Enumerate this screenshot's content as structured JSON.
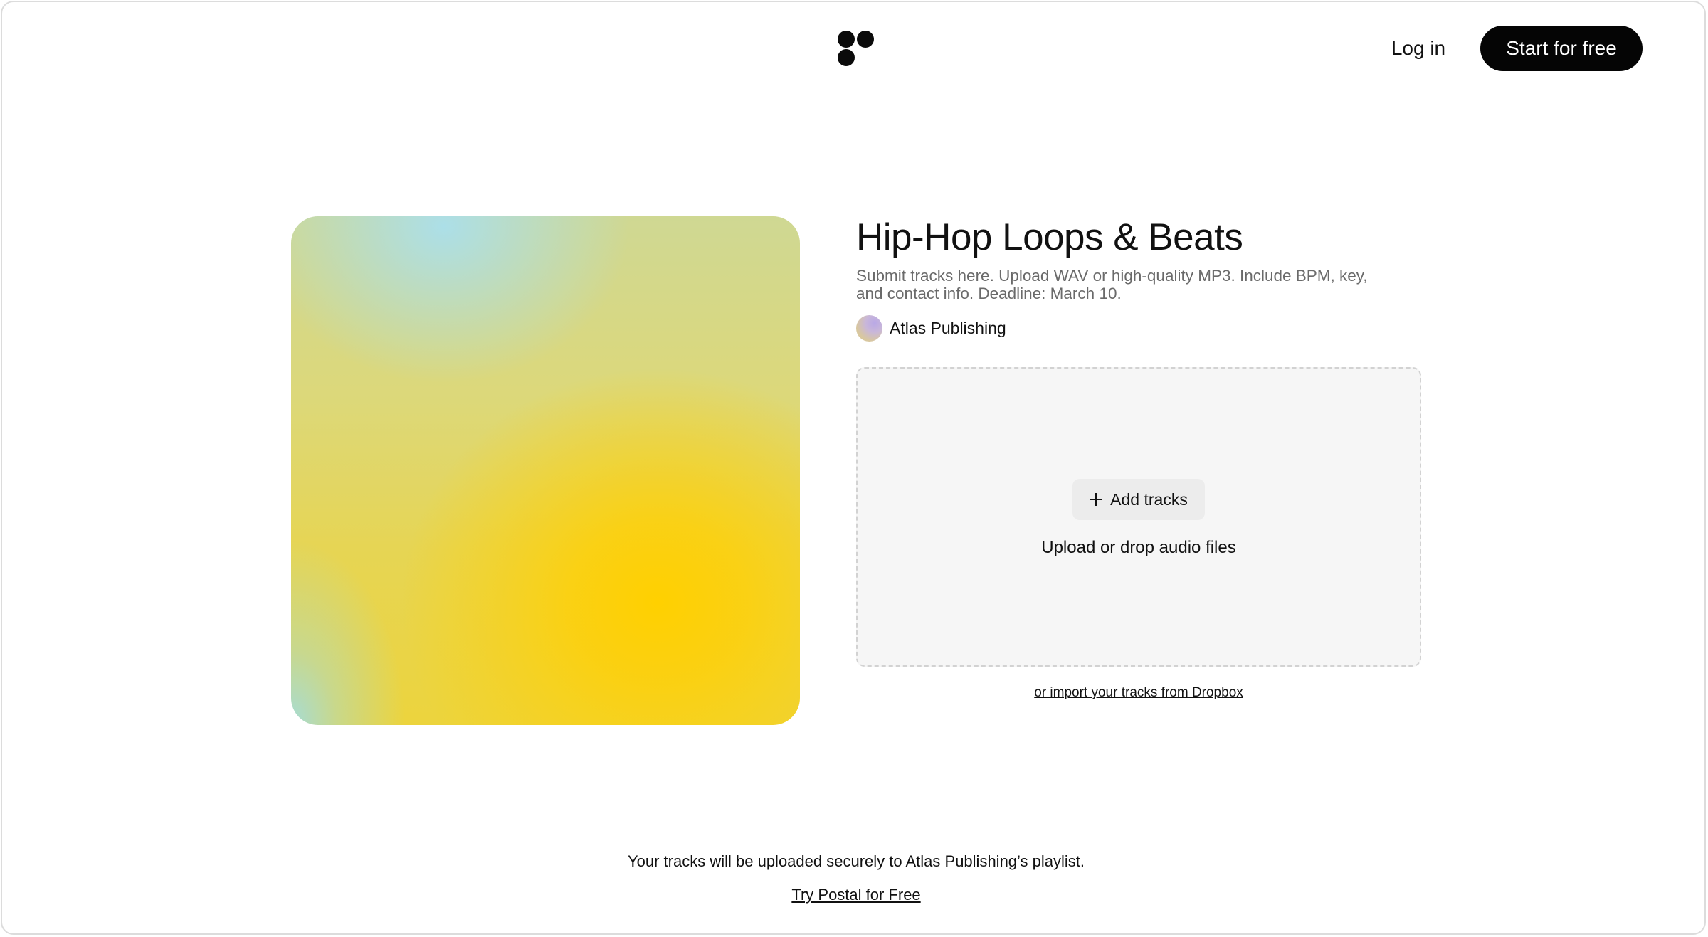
{
  "header": {
    "logo_icon": "postal-dots-logo-icon",
    "login_label": "Log in",
    "cta_label": "Start for free"
  },
  "playlist": {
    "title": "Hip-Hop Loops & Beats",
    "description": "Submit tracks here. Upload WAV or high-quality MP3. Include BPM, key, and contact info. Deadline: March 10.",
    "owner_name": "Atlas Publishing"
  },
  "upload": {
    "add_button_label": "Add tracks",
    "add_icon": "plus-icon",
    "hint": "Upload or drop audio files",
    "dropbox_link": "or import your tracks from Dropbox"
  },
  "footer": {
    "note": "Your tracks will be uploaded securely to Atlas Publishing’s playlist.",
    "link": "Try Postal for Free"
  },
  "colors": {
    "cta_background": "#050505",
    "dropzone_background": "#f6f6f6",
    "cover_accent": "#ffd000"
  }
}
